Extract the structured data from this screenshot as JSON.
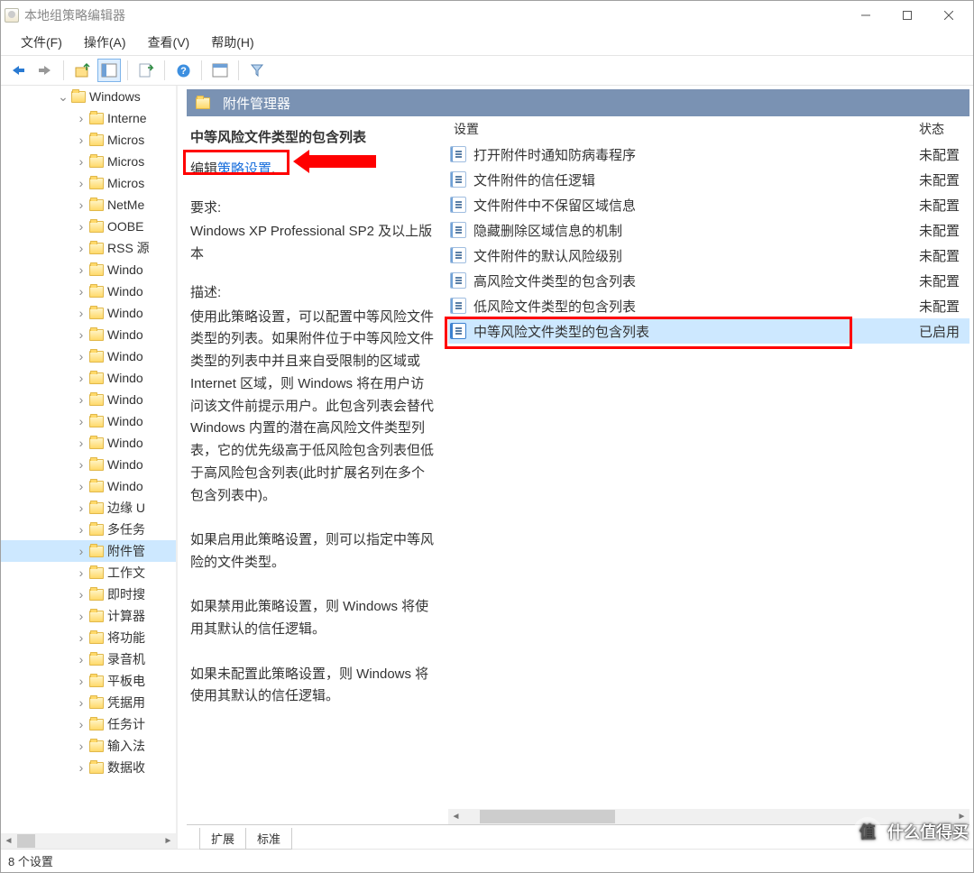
{
  "titlebar": {
    "title": "本地组策略编辑器"
  },
  "menubar": {
    "file": "文件(F)",
    "action": "操作(A)",
    "view": "查看(V)",
    "help": "帮助(H)"
  },
  "tree": {
    "parent": "Windows",
    "items": [
      "Interne",
      "Micros",
      "Micros",
      "Micros",
      "NetMe",
      "OOBE",
      "RSS 源",
      "Windo",
      "Windo",
      "Windo",
      "Windo",
      "Windo",
      "Windo",
      "Windo",
      "Windo",
      "Windo",
      "Windo",
      "Windo",
      "边缘 U",
      "多任务",
      "附件管",
      "工作文",
      "即时搜",
      "计算器",
      "将功能",
      "录音机",
      "平板电",
      "凭据用",
      "任务计",
      "输入法",
      "数据收"
    ],
    "selected_index": 20
  },
  "right_header": {
    "title": "附件管理器"
  },
  "policy_detail": {
    "name": "中等风险文件类型的包含列表",
    "edit_prefix": "编辑",
    "edit_link": "策略设置",
    "req_label": "要求:",
    "req_text": "Windows XP Professional SP2 及以上版本",
    "desc_label": "描述:",
    "desc_text_1": "使用此策略设置，可以配置中等风险文件类型的列表。如果附件位于中等风险文件类型的列表中并且来自受限制的区域或 Internet 区域，则 Windows 将在用户访问该文件前提示用户。此包含列表会替代 Windows 内置的潜在高风险文件类型列表，它的优先级高于低风险包含列表但低于高风险包含列表(此时扩展名列在多个包含列表中)。",
    "desc_text_2": "如果启用此策略设置，则可以指定中等风险的文件类型。",
    "desc_text_3": "如果禁用此策略设置，则 Windows 将使用其默认的信任逻辑。",
    "desc_text_4": "如果未配置此策略设置，则 Windows 将使用其默认的信任逻辑。"
  },
  "list": {
    "col_setting": "设置",
    "col_status": "状态",
    "rows": [
      {
        "name": "打开附件时通知防病毒程序",
        "status": "未配置",
        "selected": false
      },
      {
        "name": "文件附件的信任逻辑",
        "status": "未配置",
        "selected": false
      },
      {
        "name": "文件附件中不保留区域信息",
        "status": "未配置",
        "selected": false
      },
      {
        "name": "隐藏删除区域信息的机制",
        "status": "未配置",
        "selected": false
      },
      {
        "name": "文件附件的默认风险级别",
        "status": "未配置",
        "selected": false
      },
      {
        "name": "高风险文件类型的包含列表",
        "status": "未配置",
        "selected": false
      },
      {
        "name": "低风险文件类型的包含列表",
        "status": "未配置",
        "selected": false
      },
      {
        "name": "中等风险文件类型的包含列表",
        "status": "已启用",
        "selected": true
      }
    ]
  },
  "tabs": {
    "extended": "扩展",
    "standard": "标准"
  },
  "statusbar": {
    "text": "8 个设置"
  },
  "watermark": {
    "text": "什么值得买"
  }
}
